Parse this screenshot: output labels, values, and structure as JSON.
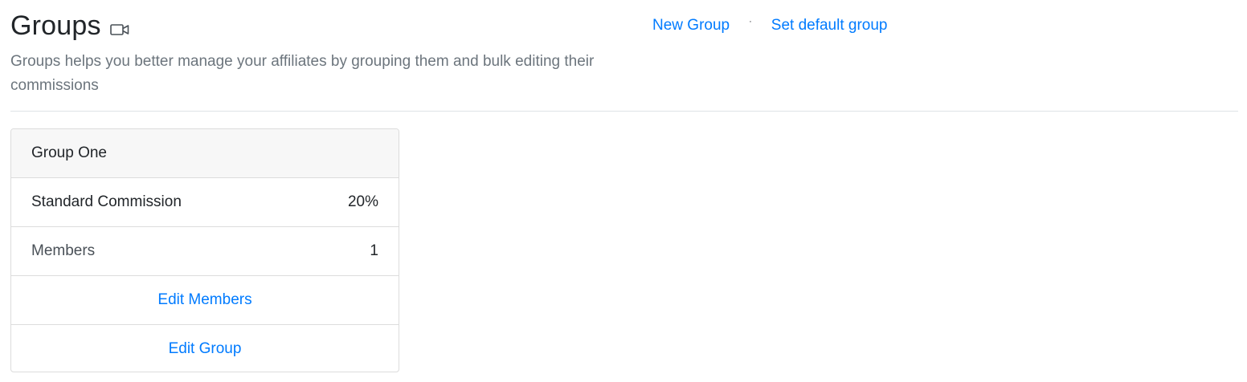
{
  "header": {
    "title": "Groups",
    "video_icon": "video-camera-icon",
    "description": "Groups helps you better manage your affiliates by grouping them and bulk editing their commissions",
    "actions": {
      "new_group": "New Group",
      "separator": "·",
      "set_default_group": "Set default group"
    }
  },
  "group_card": {
    "name": "Group One",
    "rows": [
      {
        "label": "Standard Commission",
        "value": "20%"
      },
      {
        "label": "Members",
        "value": "1"
      }
    ],
    "edit_members": "Edit Members",
    "edit_group": "Edit Group"
  },
  "colors": {
    "link": "#007bff",
    "muted_text": "#6c757d",
    "card_header_bg": "#f7f7f7",
    "border": "#dee2e6"
  }
}
